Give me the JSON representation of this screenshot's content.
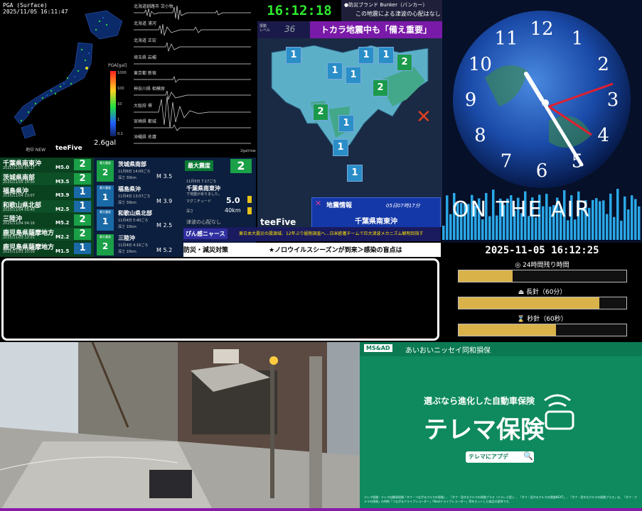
{
  "seismograph": {
    "pga_title": "PGA (Surface)",
    "pga_datetime": "2025/11/05 16:11:47",
    "pga_unit": "PGA[gal]",
    "gal_value": "2.6gal",
    "logo": "teeFive",
    "logo_sub": "地中 NEW",
    "gal_unit_right": "2gal/row",
    "colorbar_ticks": [
      "1000",
      "100",
      "10",
      "1",
      "0.1"
    ],
    "stations": [
      "北海道釧路市 苫小牧",
      "北海道 浦河",
      "北海道 正宏",
      "埼玉県 岩槻",
      "東京都 新宿",
      "神奈川県 相模原",
      "大阪府 堺",
      "宮崎県 都城",
      "沖縄県 名護"
    ]
  },
  "quake_list": [
    {
      "name": "千葉県南東沖",
      "date": "2025/11/05 07:17",
      "mag": "M5.0",
      "intensity": "2",
      "color": "#1aa047"
    },
    {
      "name": "茨城県南部",
      "date": "2025/11/05 14:00",
      "mag": "M3.5",
      "intensity": "2",
      "color": "#1aa047"
    },
    {
      "name": "福島県沖",
      "date": "2025/11/04 13:07",
      "mag": "M3.9",
      "intensity": "1",
      "color": "#1a6aa8"
    },
    {
      "name": "和歌山県北部",
      "date": "2025/11/04 05:40",
      "mag": "M2.5",
      "intensity": "1",
      "color": "#1a6aa8"
    },
    {
      "name": "三陸沖",
      "date": "2025/11/04 04:16",
      "mag": "M5.2",
      "intensity": "2",
      "color": "#1aa047"
    },
    {
      "name": "鹿児島県薩摩地方",
      "date": "2025/11/03 22:01",
      "mag": "M2.2",
      "intensity": "2",
      "color": "#1aa047"
    },
    {
      "name": "鹿児島県薩摩地方",
      "date": "2025/11/03 20:09",
      "mag": "M1.5",
      "intensity": "1",
      "color": "#1a6aa8"
    }
  ],
  "quake_detail": [
    {
      "intensity": "2",
      "cap": "最大震度",
      "name": "茨城県南部",
      "time": "11月6日 14:00ごろ",
      "depth": "深さ 30km",
      "mag": "M 3.5"
    },
    {
      "intensity": "1",
      "cap": "最大震度",
      "name": "福島県沖",
      "time": "11月4日 13:07ごろ",
      "depth": "深さ 30km",
      "mag": "M 3.9"
    },
    {
      "intensity": "1",
      "cap": "最大震度",
      "name": "和歌山県北部",
      "time": "11月4日 5:40ごろ",
      "depth": "深さ 10km",
      "mag": "M 2.5"
    },
    {
      "intensity": "2",
      "cap": "最大震度",
      "name": "三陸沖",
      "time": "11月4日 4:16ごろ",
      "depth": "深さ 10km",
      "mag": "M 5.2"
    }
  ],
  "max_intensity": {
    "label": "最大震度",
    "value": "2",
    "time": "11月5日 7:17ごろ",
    "place": "千葉県南東沖",
    "note": "で地震がありました。",
    "mag_label": "マグニチュード",
    "mag": "5.0",
    "depth_label": "深さ",
    "depth": "40km",
    "tsunami": "津波の心配なし"
  },
  "news_ticker": {
    "tag": "ぴん感ニャース",
    "text": "東日本大震災の震源域、12年ぶり掘削調査へ…日米欧著チームで巨大津波メカニズム解明目指す"
  },
  "bottom_ticker": {
    "left": "防災・減災対策",
    "right": "★ノロウイルスシーズンが到来＞感染の盲点は"
  },
  "quake_map": {
    "clock": "16:12:18",
    "shindo_label": "振動\nレベル",
    "shindo_value": "36",
    "bunker_line1": "●防災ブランド Bunker（バンカー）",
    "bunker_line2": "この地震による津波の心配はなし",
    "headline": "トカラ地震中も「備え重要」",
    "logo": "teeFive",
    "info_title": "地震情報",
    "info_mark": "✕",
    "info_time": "05日07時17分",
    "info_place": "千葉県南東沖",
    "epicenter": "✕",
    "markers": [
      {
        "v": "1",
        "cls": "s1"
      },
      {
        "v": "1",
        "cls": "s1"
      },
      {
        "v": "1",
        "cls": "s1"
      },
      {
        "v": "1",
        "cls": "s1"
      },
      {
        "v": "1",
        "cls": "s1"
      },
      {
        "v": "2",
        "cls": "s2"
      },
      {
        "v": "2",
        "cls": "s2"
      },
      {
        "v": "2",
        "cls": "s2"
      },
      {
        "v": "1",
        "cls": "s1"
      },
      {
        "v": "1",
        "cls": "s1"
      },
      {
        "v": "1",
        "cls": "s1"
      }
    ]
  },
  "clock": {
    "numbers": [
      "12",
      "1",
      "2",
      "3",
      "4",
      "5",
      "6",
      "7",
      "8",
      "9",
      "10",
      "11"
    ],
    "onair": "ON THE AIR",
    "datetime": "2025-11-05 16:12:25",
    "progress": [
      {
        "icon": "◎",
        "label": "24時間残り時間",
        "fill": 0.32
      },
      {
        "icon": "⏏",
        "label": "長針（60分）",
        "fill": 0.84
      },
      {
        "icon": "⌛",
        "label": "秒針（60秒）",
        "fill": 0.58
      }
    ]
  },
  "ad": {
    "logo": "MS&AD",
    "company": "あいおいニッセイ同和損保",
    "tagline": "選ぶなら進化した自動車保険",
    "brand": "テレマ保険",
    "search_label": "テレマにアプデ",
    "search_icon": "🔍",
    "fine": "テレマ保険：テレマ自動車保険「タフ・つながるクルマの保険」、「タフ・見守るクルマの保険プラス（ドラレコ型）」、「タフ・見守るクルマの保険NEXT」、「タフ・見守るクルマの保険プラス」は、「タフ・クルマの保険」の特約「つながるドライブレコーダー」「Nextドライブレコーダー」等をセットした商品の愛称です。"
  }
}
